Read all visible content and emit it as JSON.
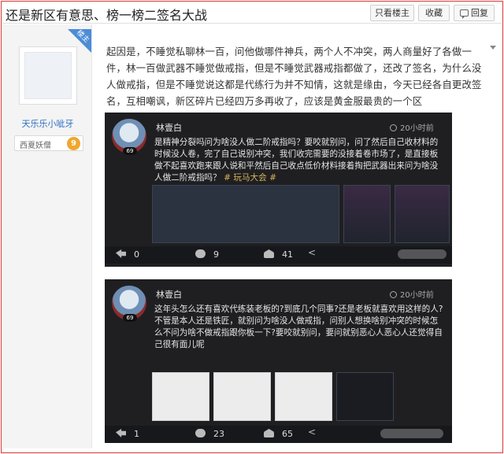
{
  "header": {
    "title": "还是新区有意思、榜一榜二签名大战",
    "buttons": {
      "only_op": "只看楼主",
      "favorite": "收藏",
      "reply": "回复"
    }
  },
  "author": {
    "badge": "楼主",
    "name": "天乐乐小呲牙",
    "level_name": "西夏妖僧",
    "level": "9"
  },
  "post": {
    "paragraph": "起因是，不睡觉私聊林一百，问他做哪件神兵，两个人不冲突，两人商量好了各做一件，林一百做武器不睡觉做戒指，但是不睡觉武器戒指都做了，还改了签名，为什么没人做戒指，但是不睡觉说这都是代练行为并不知情，这就是缘由，今天已经各自更改签名，互相嘲讽，新区碎片已经四万多再收了，应该是黄金服最贵的一个区"
  },
  "cards": [
    {
      "user": "林壹白",
      "avatar_level": "69",
      "time": "20小时前",
      "text": "是精神分裂吗问为啥没人做二阶戒指吗？要咬就别问，问了然后自己收材料的时候没人卷，完了自己说别冲突，我们收完需要的没接着卷市场了，是直接板做不起喜欢跑来跟人说和平然后自己收点低价材料接着掏把武器出来问为啥没人做二阶戒指吗？",
      "tag": "# 玩马大会 #",
      "stats": {
        "share": "0",
        "comment": "9",
        "like": "41"
      }
    },
    {
      "user": "林壹白",
      "avatar_level": "69",
      "time": "20小时前",
      "text": "这年头怎么还有喜欢代练装老板的?到底几个同事?还是老板就喜欢用这样的人?不管是本人还是铁匠，就别问为啥没人做戒指，问别人想换啥别冲突的时候怎么不问为啥不做戒指跟你板一下?要咬就别问，要问就别恶心人恶心人还觉得自己很有面儿呢",
      "stats": {
        "share": "1",
        "comment": "23",
        "like": "65"
      }
    }
  ],
  "colors": {
    "frame_border": "#d23a3a",
    "link_blue": "#2f6fc4",
    "badge_blue": "#4c8cd8",
    "card_bg": "#1f1f22"
  }
}
